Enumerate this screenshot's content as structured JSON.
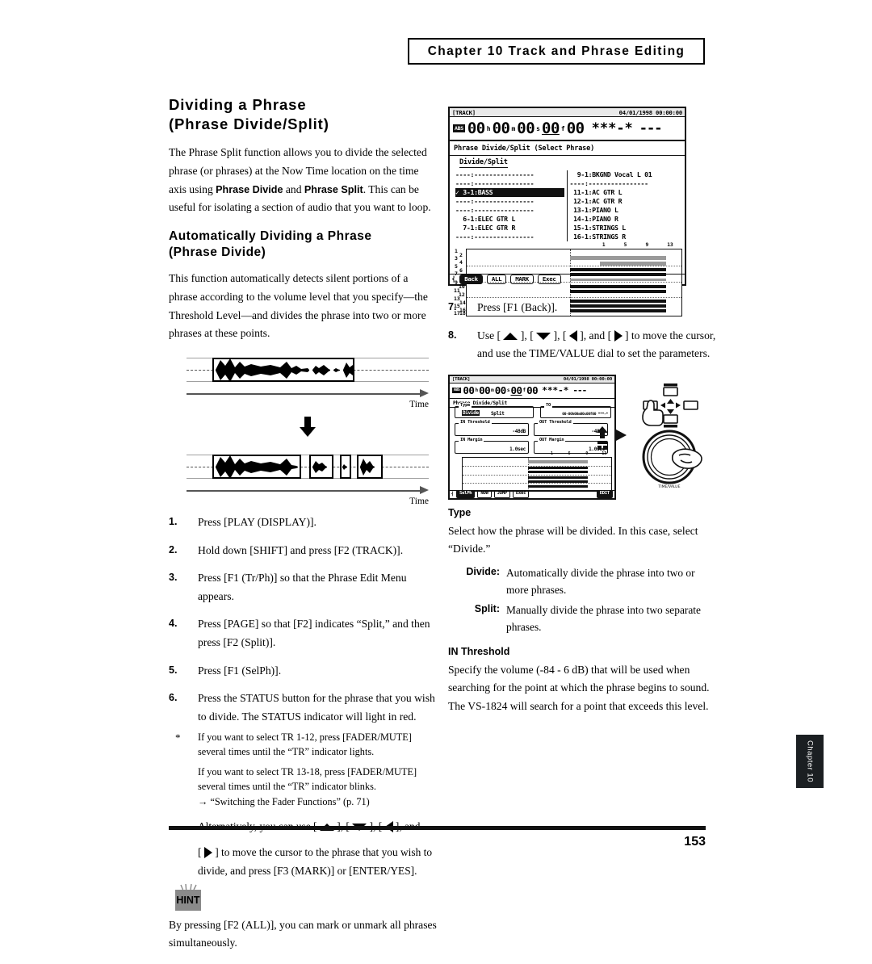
{
  "header": {
    "chapter_title": "Chapter 10 Track and Phrase Editing"
  },
  "left": {
    "section_title_line1": "Dividing a Phrase",
    "section_title_line2": "(Phrase Divide/Split)",
    "intro_part1": "The Phrase Split function allows you to divide the selected phrase (or phrases) at the Now Time location on the time axis using ",
    "intro_bold1": "Phrase Divide",
    "intro_mid": " and ",
    "intro_bold2": "Phrase Split",
    "intro_part2": ". This can be useful for isolating a section of audio that you want to loop.",
    "subsection_title_line1": "Automatically Dividing a Phrase",
    "subsection_title_line2": "(Phrase Divide)",
    "subsection_body": "This function automatically detects silent portions of a phrase according to the volume level that you specify—the Threshold Level—and divides the phrase into two or more phrases at these points.",
    "figure": {
      "axis_label_top": "Time",
      "axis_label_bottom": "Time",
      "down_arrow": "⬇"
    },
    "steps": [
      {
        "num": "1.",
        "text": "Press [PLAY (DISPLAY)]."
      },
      {
        "num": "2.",
        "text": "Hold down [SHIFT] and press [F2 (TRACK)]."
      },
      {
        "num": "3.",
        "text": "Press [F1 (Tr/Ph)] so that the Phrase Edit Menu appears."
      },
      {
        "num": "4.",
        "text": "Press [PAGE] so that [F2] indicates “Split,” and then press [F2 (Split)]."
      },
      {
        "num": "5.",
        "text": "Press [F1 (SelPh)]."
      },
      {
        "num": "6.",
        "text": "Press the STATUS button for the phrase that you wish to divide. The STATUS indicator will light in red."
      }
    ],
    "note": {
      "star": "*",
      "line1": "If you want to select TR 1-12, press [FADER/MUTE] several times until the “TR” indicator lights.",
      "line2": "If you want to select TR 13-18, press [FADER/MUTE] several times until the “TR” indicator blinks.",
      "line3": "→ “Switching the Fader Functions” (p. 71)",
      "alt_pre": "Alternatively, you can use [",
      "alt_mid1": "], [",
      "alt_mid2": "], [",
      "alt_mid3": "], and",
      "alt_pre2": "[",
      "alt_post2": "] to move the cursor to the phrase that you wish to divide, and press [F3 (MARK)] or [ENTER/YES]."
    },
    "hint": {
      "badge_label": "HINT",
      "text": "By pressing [F2 (ALL)], you can mark or unmark all phrases simultaneously."
    }
  },
  "lcd1": {
    "titlebar_left": "[TRACK]",
    "titlebar_right": "04/01/1998 00:00:00",
    "abs_chip": "ABS",
    "tc": {
      "h": "00",
      "h_unit": "h",
      "m": "00",
      "m_unit": "m",
      "s": "00",
      "s_unit": "s",
      "f": "00",
      "f_unit": "f",
      "sub": "00",
      "stars": "***-*",
      "dashes": "---"
    },
    "dialog_title": "Phrase Divide/Split (Select Phrase)",
    "subtitle": "Divide/Split",
    "phrase_list_left": [
      "----:----------------",
      "----:----------------",
      "✓ 3-1:BASS",
      "----:----------------",
      "----:----------------",
      "  6-1:ELEC GTR L",
      "  7-1:ELEC GTR R",
      "----:----------------"
    ],
    "selected_left_index": 2,
    "phrase_list_right": [
      "  9-1:BKGND Vocal L 01",
      "----:----------------",
      " 11-1:AC GTR L",
      " 12-1:AC GTR R",
      " 13-1:PIANO L",
      " 14-1:PIANO R",
      " 15-1:STRINGS L",
      " 16-1:STRINGS R"
    ],
    "ruler_marks": [
      "1",
      "5",
      "9",
      "13"
    ],
    "track_numbers": [
      "1",
      "2",
      "3",
      "4",
      "5",
      "6",
      "7",
      "8",
      "9",
      "10",
      "11",
      "12",
      "13",
      "14",
      "15",
      "16",
      "17",
      "18"
    ],
    "fkeys": [
      {
        "label": "Back",
        "inverted": true
      },
      {
        "label": "ALL",
        "inverted": false
      },
      {
        "label": "MARK",
        "inverted": false
      },
      {
        "label": "Exec",
        "inverted": false
      }
    ]
  },
  "right": {
    "steps": [
      {
        "num": "7.",
        "text": "Press [F1 (Back)]."
      },
      {
        "num": "8.",
        "pre": "Use [",
        "mid1": "], [",
        "mid2": "], [",
        "mid3": "], and [",
        "post": "] to move the cursor, and use the TIME/VALUE dial to set the parameters."
      }
    ],
    "type_heading": "Type",
    "type_body": "Select how the phrase will be divided. In this case, select “Divide.”",
    "defs": [
      {
        "term": "Divide:",
        "desc": "Automatically divide the phrase into two or more phrases."
      },
      {
        "term": "Split:",
        "desc": "Manually divide the phrase into two separate phrases."
      }
    ],
    "threshold_heading": "IN Threshold",
    "threshold_body": "Specify the volume (-84 - 6 dB) that will be used when searching for the point at which the phrase begins to sound. The VS-1824 will search for a point that exceeds this level."
  },
  "lcd2": {
    "titlebar_left": "[TRACK]",
    "titlebar_right": "04/01/1998 00:00:00",
    "abs_chip": "ABS",
    "tc": {
      "h": "00",
      "h_unit": "h",
      "m": "00",
      "m_unit": "m",
      "s": "00",
      "s_unit": "s",
      "f": "00",
      "f_unit": "f",
      "sub": "00",
      "stars": "***-*",
      "dashes": "---"
    },
    "dialog_title": "Phrase Divide/Split",
    "params": [
      {
        "label": "Type",
        "value_inverted": "Divide",
        "value_plain": "Split"
      },
      {
        "label": "TO",
        "value": "00-00h00m00s00f00 ***-*"
      },
      {
        "label": "IN Threshold",
        "value": "-48dB"
      },
      {
        "label": "OUT Threshold",
        "value": "-48dB"
      },
      {
        "label": "IN Margin",
        "value": "1.0sec"
      },
      {
        "label": "OUT Margin",
        "value": "1.0sec"
      }
    ],
    "ruler_marks": [
      "1",
      "5",
      "9",
      "13"
    ],
    "fkeys": [
      {
        "label": "SelPh",
        "inverted": true
      },
      {
        "label": "NOW",
        "inverted": false
      },
      {
        "label": "JUMP",
        "inverted": false
      },
      {
        "label": "Exec",
        "inverted": false
      },
      {
        "label": "EDIT",
        "inverted": true
      }
    ],
    "dial_caption": "TIME/VALUE"
  },
  "footer": {
    "chapter_tab": "Chapter 10",
    "page_number": "153"
  },
  "colors": {
    "ink": "#000000",
    "lcd_border": "#111111",
    "hint_badge_bg": "#8a8a8a",
    "tab_bg": "#1b1f22",
    "rule_grey": "#a0a0a0"
  }
}
